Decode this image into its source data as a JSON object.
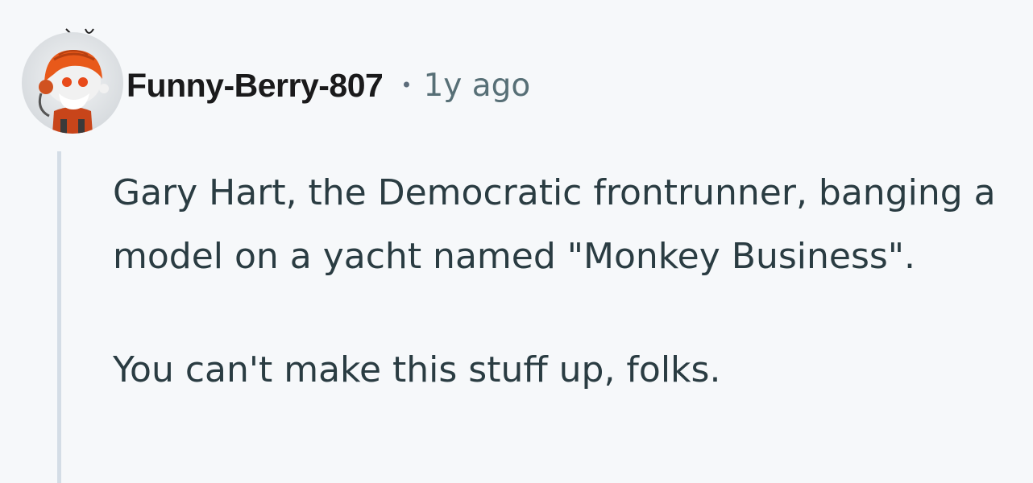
{
  "comment": {
    "author": {
      "username": "Funny-Berry-807",
      "avatar_icon": "snoo-avatar-icon",
      "separator": "•",
      "timestamp": "1y ago"
    },
    "paragraphs": [
      "Gary Hart, the Democratic frontrunner, banging a model on a yacht named \"Monkey Business\".",
      "You can't make this stuff up, folks."
    ]
  },
  "colors": {
    "background": "#f6f8fa",
    "username": "#1a1a1b",
    "meta": "#576f76",
    "body_text": "#2a3c42",
    "thread_line": "#d4dde6",
    "avatar_orange": "#e8591a"
  }
}
